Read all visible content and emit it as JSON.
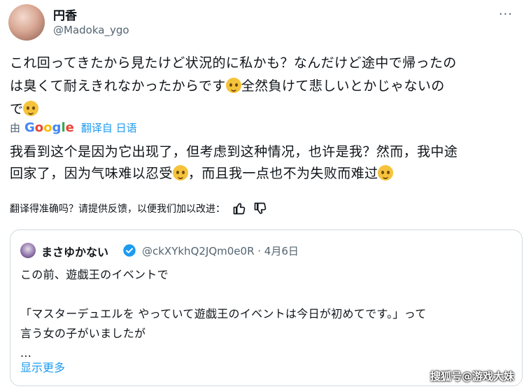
{
  "author": {
    "name": "円香",
    "handle": "@Madoka_ygo"
  },
  "tweet": {
    "line1": "これ回ってきたから見たけど状況的に私かも？なんだけど途中で帰ったの",
    "line2a": "は臭くて耐えきれなかったからです",
    "line2b": "全然負けて悲しいとかじゃないの",
    "line3": "で"
  },
  "translation_bar": {
    "by": "由",
    "google": [
      "G",
      "o",
      "o",
      "g",
      "l",
      "e"
    ],
    "link": "翻译自 日语"
  },
  "translation": {
    "line1": "我看到这个是因为它出现了，但考虑到这种情况，也许是我？然而，我中途",
    "line2a": "回家了，因为气味难以忍受",
    "line2b": "，而且我一点也不为失败而难过"
  },
  "feedback": {
    "text": "翻译得准确吗？请提供反馈，以便我们加以改进："
  },
  "quote": {
    "name": "まさゆかない",
    "meta": "@ckXYkhQ2JQm0e0R · 4月6日",
    "text": "この前、遊戯王のイベントで\n\n「マスターデュエルを やっていて遊戯王のイベントは今日が初めてです。」って\n言う女の子がいましたが\n...",
    "show_more": "显示更多"
  },
  "watermark": "搜狐号@游戏大妹",
  "colors": {
    "accent": "#1d9bf0",
    "muted": "#536471",
    "text": "#0f1419",
    "border": "#cfd9de"
  },
  "icons": [
    "more-icon",
    "emoji-icon",
    "thumbs-up-icon",
    "thumbs-down-icon",
    "verified-badge-icon"
  ]
}
